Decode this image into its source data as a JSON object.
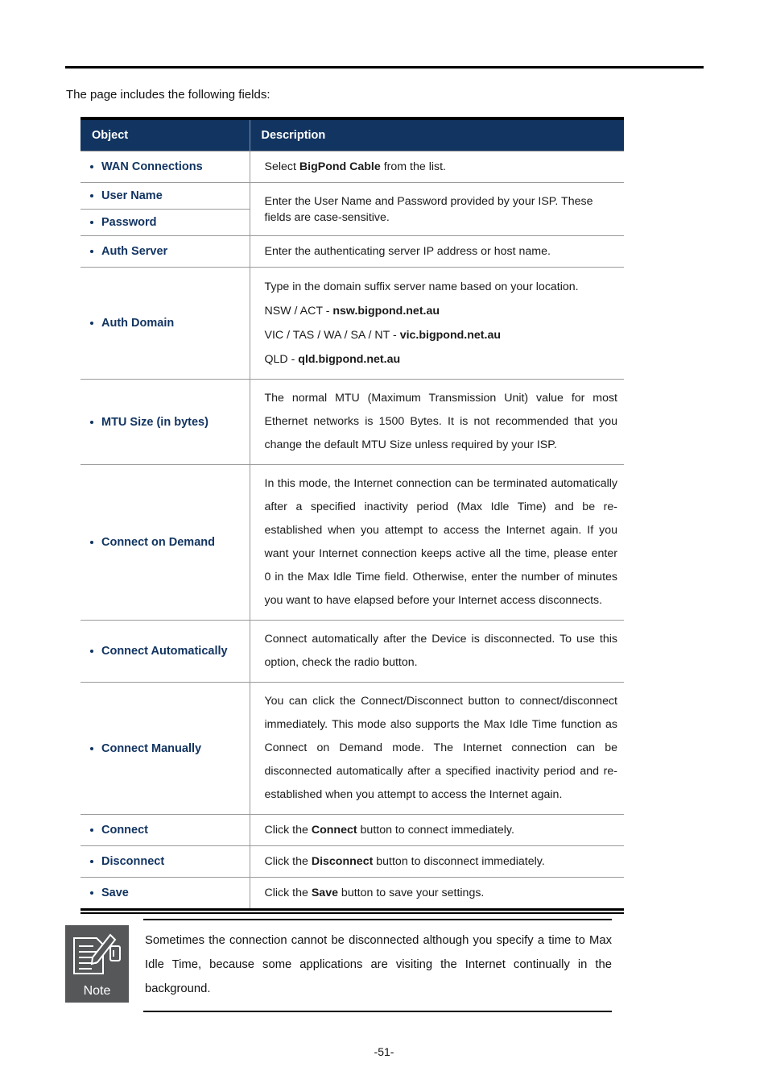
{
  "document": {
    "intro_text": "The page includes the following fields:",
    "page_number": "-51-"
  },
  "table": {
    "columns": [
      "Object",
      "Description"
    ],
    "rows": [
      {
        "object": "WAN Connections",
        "description_runs": [
          {
            "text": "Select ",
            "bold": false
          },
          {
            "text": "BigPond Cable",
            "bold": true
          },
          {
            "text": " from the list.",
            "bold": false
          }
        ]
      },
      {
        "object": "User Name",
        "merged_with_next": true,
        "description_runs": [
          {
            "text": "Enter the User Name and Password provided by your ISP. These fields are case-sensitive.",
            "bold": false
          }
        ]
      },
      {
        "object": "Password",
        "merged_into_previous": true
      },
      {
        "object": "Auth Server",
        "description_runs": [
          {
            "text": "Enter the authenticating server IP address or host name.",
            "bold": false
          }
        ]
      },
      {
        "object": "Auth Domain",
        "description_lines": [
          [
            {
              "text": "Type in the domain suffix server name based on your location.",
              "bold": false
            }
          ],
          [
            {
              "text": "NSW / ACT - ",
              "bold": false
            },
            {
              "text": "nsw.bigpond.net.au",
              "bold": true
            }
          ],
          [
            {
              "text": "VIC / TAS / WA / SA / NT - ",
              "bold": false
            },
            {
              "text": "vic.bigpond.net.au",
              "bold": true
            }
          ],
          [
            {
              "text": "QLD - ",
              "bold": false
            },
            {
              "text": "qld.bigpond.net.au",
              "bold": true
            }
          ]
        ]
      },
      {
        "object": "MTU Size (in bytes)",
        "description_runs": [
          {
            "text": "The normal MTU (Maximum Transmission Unit) value for most Ethernet networks is 1500 Bytes. It is not recommended that you change the default MTU Size unless required by your ISP.",
            "bold": false
          }
        ]
      },
      {
        "object": "Connect on Demand",
        "description_runs": [
          {
            "text": "In this mode, the Internet connection can be terminated automatically after a specified inactivity period (Max Idle Time) and be re-established when you attempt to access the Internet again. If you want your Internet connection keeps active all the time, please enter 0 in the Max Idle Time field. Otherwise, enter the number of minutes you want to have elapsed before your Internet access disconnects.",
            "bold": false
          }
        ]
      },
      {
        "object": "Connect Automatically",
        "description_runs": [
          {
            "text": "Connect automatically after the Device is disconnected. To use this option, check the radio button.",
            "bold": false
          }
        ]
      },
      {
        "object": "Connect Manually",
        "description_runs": [
          {
            "text": "You can click the Connect/Disconnect button to connect/disconnect immediately. This mode also supports the Max Idle Time function as Connect on Demand mode. The Internet connection can be disconnected automatically after a specified inactivity period and re-established when you attempt to access the Internet again.",
            "bold": false
          }
        ]
      },
      {
        "object": "Connect",
        "description_runs": [
          {
            "text": "Click the ",
            "bold": false
          },
          {
            "text": "Connect",
            "bold": true
          },
          {
            "text": " button to connect immediately.",
            "bold": false
          }
        ]
      },
      {
        "object": "Disconnect",
        "description_runs": [
          {
            "text": "Click the ",
            "bold": false
          },
          {
            "text": "Disconnect",
            "bold": true
          },
          {
            "text": " button to disconnect immediately.",
            "bold": false
          }
        ]
      },
      {
        "object": "Save",
        "description_runs": [
          {
            "text": "Click the ",
            "bold": false
          },
          {
            "text": "Save",
            "bold": true
          },
          {
            "text": " button to save your settings.",
            "bold": false
          }
        ]
      }
    ]
  },
  "note": {
    "icon_label": "Note",
    "text": "Sometimes the connection cannot be disconnected although you specify a time to Max Idle Time, because some applications are visiting the Internet continually in the background."
  },
  "colors": {
    "header_bg": "#123461",
    "object_text": "#123461",
    "body_text": "#1a1a1a",
    "rule": "#000000",
    "grid": "#9a9a9a",
    "note_icon_bg": "#555759"
  }
}
